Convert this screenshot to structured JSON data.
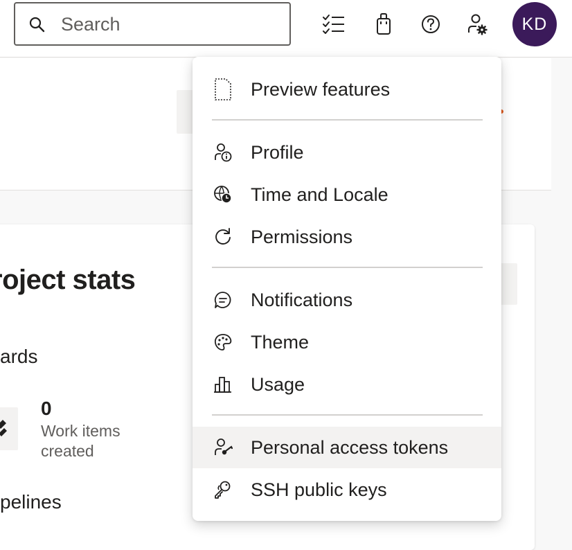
{
  "topbar": {
    "search": {
      "placeholder": "Search",
      "value": ""
    },
    "icons": [
      {
        "name": "work-items-icon"
      },
      {
        "name": "marketplace-bag-icon"
      },
      {
        "name": "help-icon"
      },
      {
        "name": "user-settings-icon"
      }
    ],
    "avatar": {
      "initials": "KD",
      "color": "#3b1a5a"
    }
  },
  "background": {
    "card_title": "Project stats",
    "card_title_visible": "roject stats",
    "sections": [
      {
        "label": "Boards",
        "visible": "ards"
      },
      {
        "label": "Pipelines",
        "visible": "pelines"
      }
    ],
    "metric": {
      "value": "0",
      "label": "Work items created"
    }
  },
  "menu": {
    "groups": [
      [
        {
          "label": "Preview features",
          "icon": "preview-features-icon"
        }
      ],
      [
        {
          "label": "Profile",
          "icon": "profile-icon"
        },
        {
          "label": "Time and Locale",
          "icon": "time-locale-icon"
        },
        {
          "label": "Permissions",
          "icon": "permissions-icon"
        }
      ],
      [
        {
          "label": "Notifications",
          "icon": "notifications-icon"
        },
        {
          "label": "Theme",
          "icon": "theme-palette-icon"
        },
        {
          "label": "Usage",
          "icon": "usage-chart-icon"
        }
      ],
      [
        {
          "label": "Personal access tokens",
          "icon": "personal-access-tokens-icon",
          "highlighted": true
        },
        {
          "label": "SSH public keys",
          "icon": "ssh-keys-icon"
        }
      ]
    ]
  },
  "colors": {
    "accent_avatar": "#3b1a5a",
    "hover": "#f3f2f1",
    "text": "#201f1e",
    "secondary_text": "#605e5c"
  }
}
